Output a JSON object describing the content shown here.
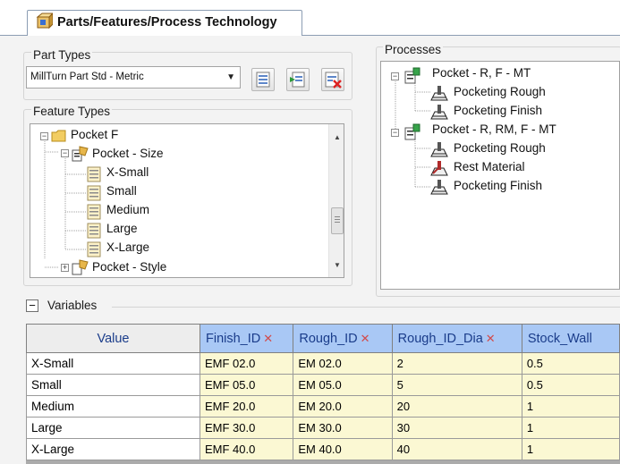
{
  "tab": {
    "title": "Parts/Features/Process Technology"
  },
  "part_types": {
    "label": "Part Types",
    "selected": "MillTurn Part Std - Metric",
    "buttons": [
      "new-list-icon",
      "import-icon",
      "delete-list-icon"
    ]
  },
  "feature_types": {
    "label": "Feature Types",
    "tree": {
      "root": "Pocket F",
      "group1": "Pocket - Size",
      "items": [
        "X-Small",
        "Small",
        "Medium",
        "Large",
        "X-Large"
      ],
      "group2": "Pocket - Style"
    }
  },
  "processes": {
    "label": "Processes",
    "groups": [
      {
        "name": "Pocket - R, F - MT",
        "ops": [
          "Pocketing Rough",
          "Pocketing Finish"
        ]
      },
      {
        "name": "Pocket - R, RM, F - MT",
        "ops": [
          "Pocketing Rough",
          "Rest Material",
          "Pocketing Finish"
        ]
      }
    ]
  },
  "variables": {
    "label": "Variables",
    "toggle": "−",
    "columns": [
      "Value",
      "Finish_ID",
      "Rough_ID",
      "Rough_ID_Dia",
      "Stock_Wall"
    ],
    "remove_glyph": "✕",
    "rows": [
      [
        "X-Small",
        "EMF 02.0",
        "EM 02.0",
        "2",
        "0.5"
      ],
      [
        "Small",
        "EMF 05.0",
        "EM 05.0",
        "5",
        "0.5"
      ],
      [
        "Medium",
        "EMF 20.0",
        "EM 20.0",
        "20",
        "1"
      ],
      [
        "Large",
        "EMF 30.0",
        "EM 30.0",
        "30",
        "1"
      ],
      [
        "X-Large",
        "EMF 40.0",
        "EM 40.0",
        "40",
        "1"
      ]
    ]
  }
}
